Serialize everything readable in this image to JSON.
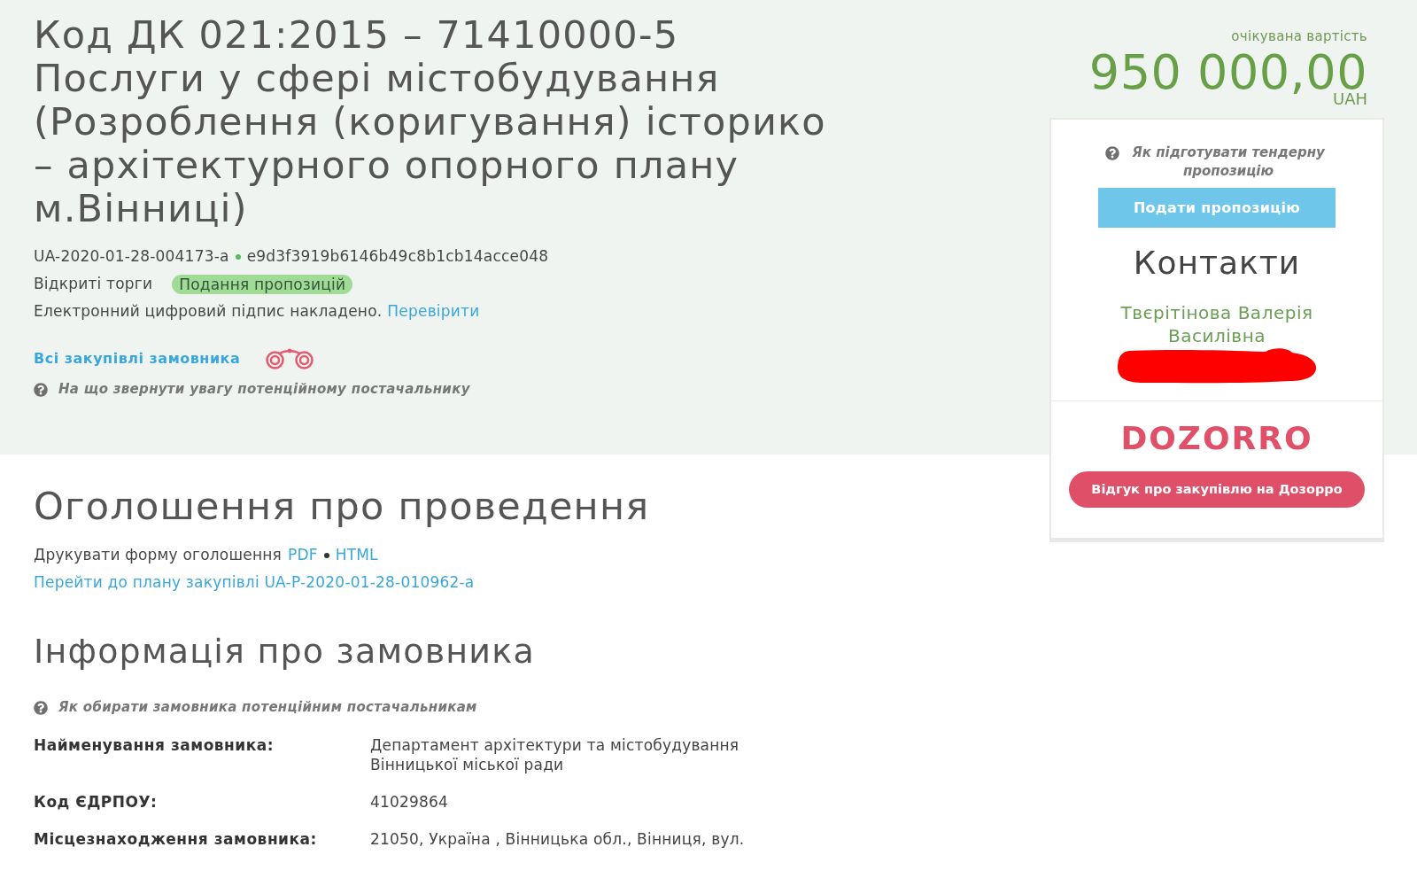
{
  "header": {
    "cpv_code": "Код ДК 021:2015 – 71410000-5",
    "subject": "Послуги у сфері містобудування (Розроблення (коригування) історико – архітектурного опорного плану м.Вінниці)",
    "tender_id": "UA-2020-01-28-004173-a",
    "hash": "e9d3f3919b6146b49c8b1cb14acce048",
    "procedure_type": "Відкриті торги",
    "status_badge": "Подання пропозицій",
    "signature_note": "Електронний цифровий підпис накладено.",
    "signature_link": "Перевірити",
    "customer_link": "Всі закупівлі замовника",
    "help": "На що звернути увагу потенційному постачальнику"
  },
  "price": {
    "label": "очікувана вартість",
    "amount": "950 000,00",
    "currency": "UAH"
  },
  "sidebar": {
    "help": "Як підготувати тендерну пропозицію",
    "submit_button": "Подати пропозицію",
    "contacts_title": "Контакти",
    "contact_name": "Твєрітінова Валерія Василівна",
    "logo": "DOZORRO",
    "feedback_button": "Відгук про закупівлю на Дозорро"
  },
  "announcement": {
    "title": "Оголошення про проведення",
    "print_label": "Друкувати форму оголошення",
    "print_links": [
      "PDF",
      "HTML"
    ],
    "plan_link": "Перейти до плану закупівлі UA-P-2020-01-28-010962-a"
  },
  "customer": {
    "title": "Інформація про замовника",
    "help": "Як обирати замовника потенційним постачальникам",
    "rows": [
      {
        "label": "Найменування замовника:",
        "value": "Департамент архітектури та містобудування Вінницької міської ради"
      },
      {
        "label": "Код ЄДРПОУ:",
        "value": "41029864"
      },
      {
        "label": "Місцезнаходження замовника:",
        "value": "21050, Україна , Вінницька обл., Вінниця, вул."
      }
    ]
  }
}
